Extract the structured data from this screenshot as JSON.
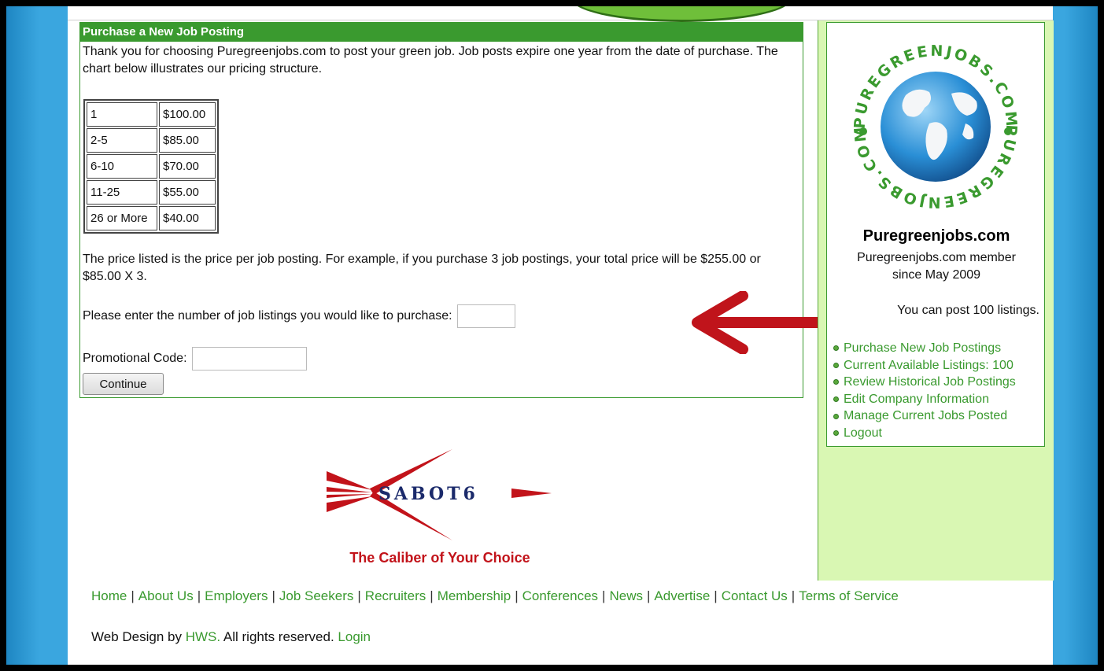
{
  "main": {
    "title": "Purchase a New Job Posting",
    "intro": "Thank you for choosing Puregreenjobs.com to post your green job. Job posts expire one year from the date of purchase. The chart below illustrates our pricing structure.",
    "pricing": [
      {
        "qty": "1",
        "price": "$100.00"
      },
      {
        "qty": "2-5",
        "price": "$85.00"
      },
      {
        "qty": "6-10",
        "price": "$70.00"
      },
      {
        "qty": "11-25",
        "price": "$55.00"
      },
      {
        "qty": "26 or More",
        "price": "$40.00"
      }
    ],
    "note": "The price listed is the price per job posting. For example, if you purchase 3 job postings, your total price will be $255.00 or $85.00 X 3.",
    "quantity_label": "Please enter the number of job listings you would like to purchase:",
    "quantity_value": "",
    "promo_label": "Promotional Code:",
    "promo_value": "",
    "continue_label": "Continue"
  },
  "sidebar": {
    "logo_text_top": "PUREGREENJOBS.COM",
    "logo_text_bottom": "PUREGREENJOBS.COM",
    "company": "Puregreenjobs.com",
    "member_line1": "Puregreenjobs.com member",
    "member_line2": "since May 2009",
    "listings": "You can post 100 listings.",
    "links": [
      "Purchase New Job Postings",
      "Current Available Listings: 100",
      "Review Historical Job Postings",
      "Edit Company Information",
      "Manage Current Jobs Posted",
      "Logout"
    ]
  },
  "banner": {
    "name": "SABOT6",
    "tagline": "The Caliber of Your Choice"
  },
  "footer": {
    "links": [
      "Home",
      "About Us",
      "Employers",
      "Job Seekers",
      "Recruiters",
      "Membership",
      "Conferences",
      "News",
      "Advertise",
      "Contact Us",
      "Terms of Service"
    ],
    "credit_prefix": "Web Design by",
    "credit_link": "HWS.",
    "credit_middle": "All rights reserved.",
    "login_label": "Login"
  },
  "colors": {
    "accent_green": "#3a9a2f",
    "sidebar_bg": "#d9f7b3",
    "page_bg_blue": "#3aa6df",
    "arrow_red": "#c0141b"
  }
}
